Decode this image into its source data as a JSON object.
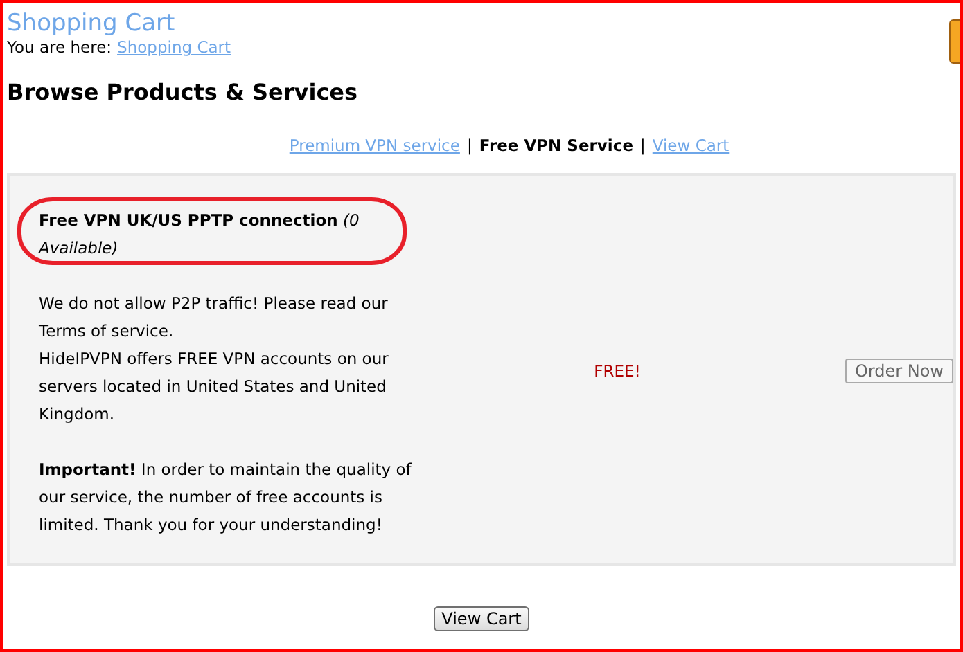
{
  "page_title": "Shopping Cart",
  "breadcrumb": {
    "label": "You are here:",
    "link": "Shopping Cart"
  },
  "heading": "Browse Products & Services",
  "nav": [
    {
      "label": "Premium VPN service",
      "selected": false
    },
    {
      "label": "Free VPN Service",
      "selected": true,
      "separator": "|"
    },
    {
      "label": "View Cart",
      "selected": false,
      "separator": "|"
    }
  ],
  "product": {
    "name": "Free VPN UK/US PPTP connection",
    "availability": "(0 Available)",
    "description": [
      "We do not allow P2P traffic! Please read our Terms of service.",
      "HideIPVPN offers FREE VPN accounts on our servers located in United States and United Kingdom."
    ],
    "notice": "**Important!** In order to maintain the quality of our service, the number of free accounts is limited. Thank you for your understanding!",
    "price": "FREE!",
    "order_button": "Order Now",
    "highlighted": true
  },
  "footer_button": "View Cart"
}
